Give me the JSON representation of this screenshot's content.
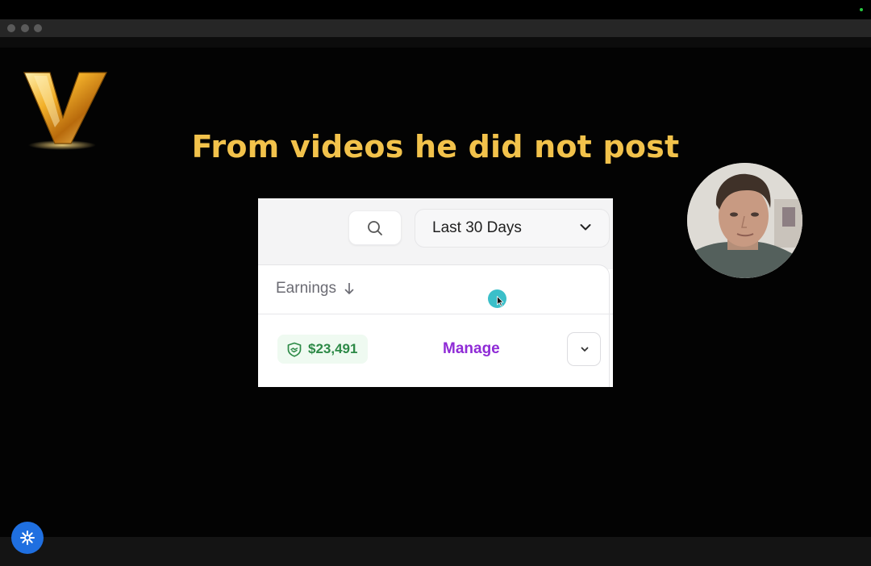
{
  "headline": "From videos he did not post",
  "card": {
    "date_range": "Last 30 Days",
    "column_header": "Earnings",
    "earnings_value": "$23,491",
    "manage_label": "Manage"
  },
  "icons": {
    "logo": "gold-v-logo",
    "search": "search-icon",
    "dropdown": "chevron-down-icon",
    "sort": "arrow-down-icon",
    "earnings": "handshake-shield-icon",
    "expand": "chevron-down-icon",
    "fab": "asterisk-icon"
  },
  "colors": {
    "headline": "#f2c24b",
    "earnings_text": "#2d8a47",
    "earnings_badge_bg": "#effaf1",
    "manage": "#8f2bd6",
    "cursor_highlight": "#3bbfc9",
    "fab": "#1f6fe0"
  }
}
